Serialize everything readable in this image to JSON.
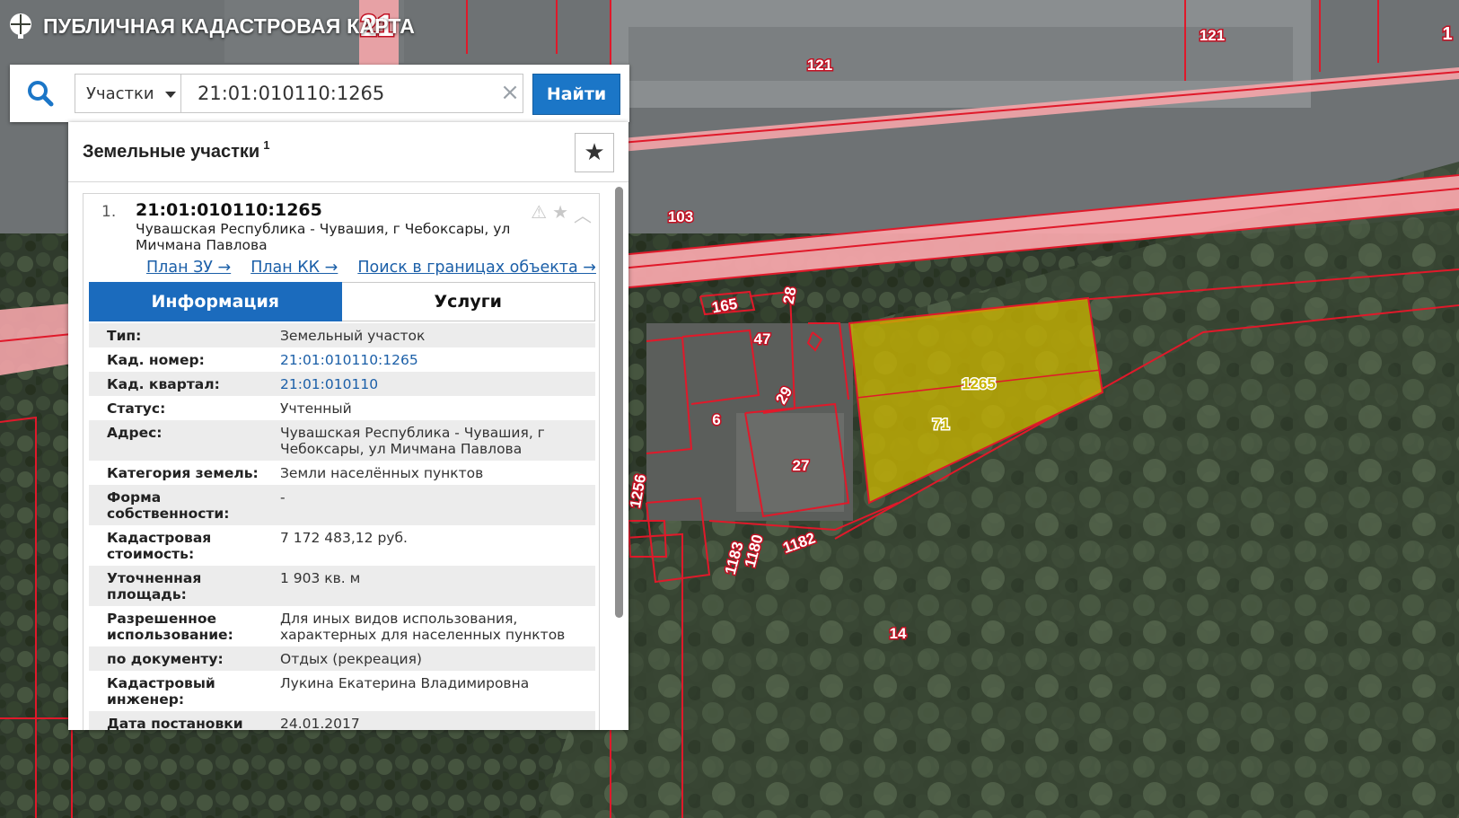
{
  "header": {
    "title": "ПУБЛИЧНАЯ КАДАСТРОВАЯ КАРТА"
  },
  "search": {
    "type_label": "Участки",
    "query": "21:01:010110:1265",
    "clear_symbol": "×",
    "button_label": "Найти"
  },
  "panel": {
    "title": "Земельные участки",
    "count": "1",
    "result": {
      "index": "1.",
      "cad_number": "21:01:010110:1265",
      "address": "Чувашская Республика - Чувашия, г Чебоксары, ул Мичмана Павлова",
      "links": [
        "План ЗУ →",
        "План КК →",
        "Поиск в границах объекта →"
      ],
      "tabs": [
        "Информация",
        "Услуги"
      ],
      "info": [
        {
          "key": "Тип:",
          "value": "Земельный участок"
        },
        {
          "key": "Кад. номер:",
          "value": "21:01:010110:1265"
        },
        {
          "key": "Кад. квартал:",
          "value": "21:01:010110"
        },
        {
          "key": "Статус:",
          "value": "Учтенный"
        },
        {
          "key": "Адрес:",
          "value": "Чувашская Республика - Чувашия, г Чебоксары, ул Мичмана Павлова"
        },
        {
          "key": "Категория земель:",
          "value": "Земли населённых пунктов"
        },
        {
          "key": "Форма собственности:",
          "value": "-"
        },
        {
          "key": "Кадастровая стоимость:",
          "value": "7 172 483,12 руб."
        },
        {
          "key": "Уточненная площадь:",
          "value": "1 903 кв. м"
        },
        {
          "key": "Разрешенное использование:",
          "value": "Для иных видов использования, характерных для населенных пунктов"
        },
        {
          "key": "по документу:",
          "value": "Отдых (рекреация)"
        },
        {
          "key": "Кадастровый инженер:",
          "value": "Лукина Екатерина Владимировна"
        },
        {
          "key": "Дата постановки",
          "value": "24.01.2017"
        }
      ]
    }
  },
  "map": {
    "labels": [
      "121",
      "121",
      "103",
      "165",
      "28",
      "47",
      "29",
      "6",
      "27",
      "1265",
      "71",
      "1256",
      "1180",
      "1183",
      "1182",
      "14",
      "21",
      "1"
    ],
    "colors": {
      "parcel_fill": "#c8b400",
      "boundary": "#e0192a",
      "road_band": "#f4a5aa",
      "search_button": "#1b76c7"
    }
  }
}
